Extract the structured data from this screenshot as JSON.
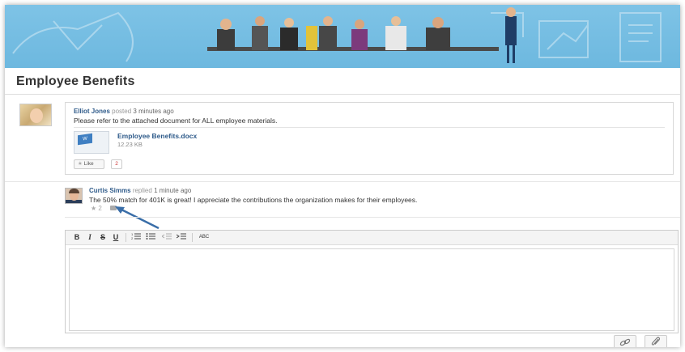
{
  "page": {
    "title": "Employee Benefits"
  },
  "post": {
    "author": "Elliot Jones",
    "action": "posted",
    "time": "3 minutes ago",
    "text": "Please refer to the attached document for ALL employee materials.",
    "attachment": {
      "name": "Employee Benefits.docx",
      "size": "12.23 KB",
      "thumb_label": "W"
    },
    "like_label": "Like",
    "like_count": "2"
  },
  "reply": {
    "author": "Curtis Simms",
    "action": "replied",
    "time": "1 minute ago",
    "text": "The 50% match for 401K is great! I appreciate the contributions the organization makes for their employees.",
    "star_count": "2"
  },
  "editor": {
    "toolbar": {
      "bold": "B",
      "italic": "I",
      "strike": "S",
      "underline": "U",
      "spell": "ABC"
    }
  },
  "icons": {
    "star": "star-icon",
    "comment": "comment-icon",
    "link": "link-icon",
    "attach": "paperclip-icon"
  },
  "colors": {
    "banner": "#7ec3e6",
    "link": "#2f5b8a",
    "arrow": "#3a6ea8"
  }
}
